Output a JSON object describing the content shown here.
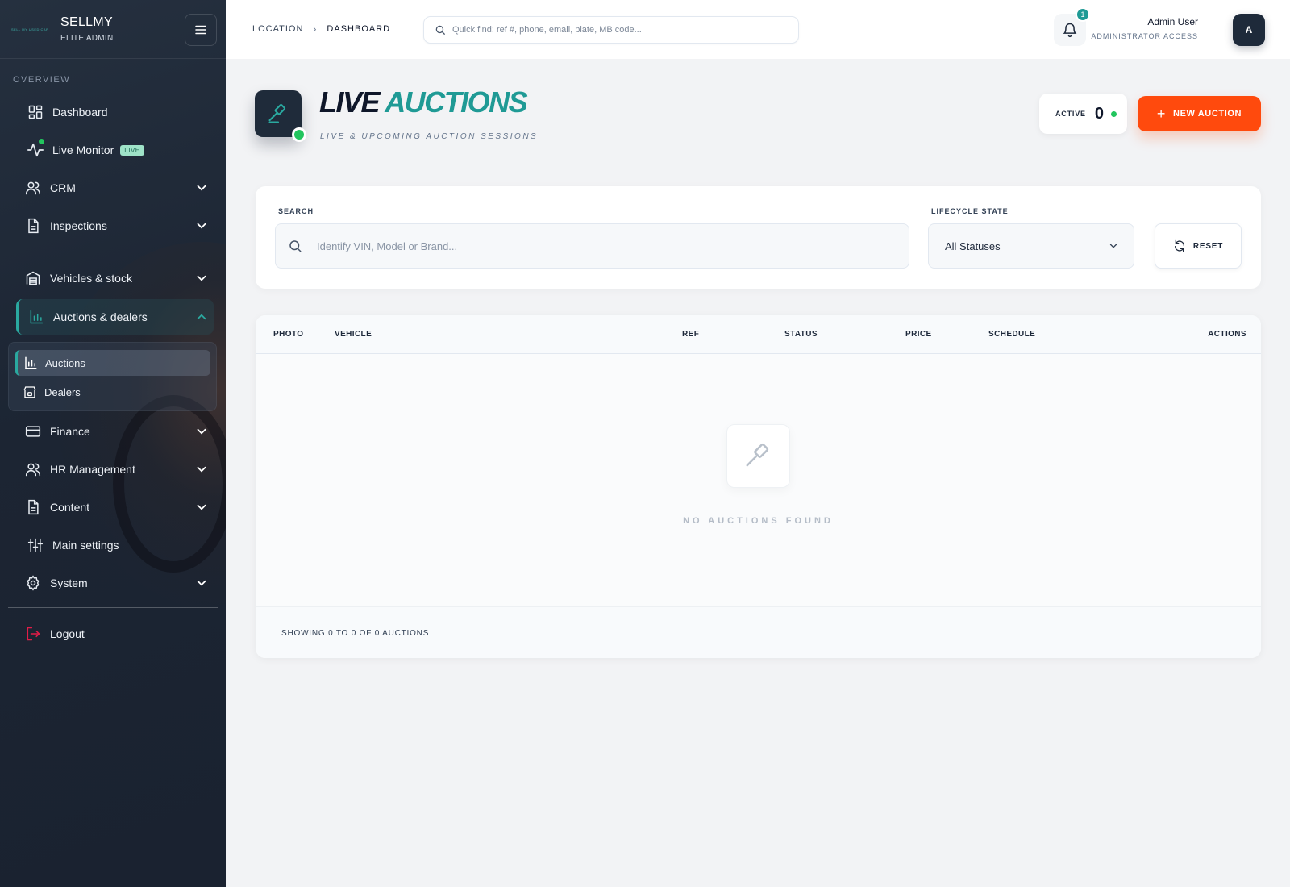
{
  "brand": {
    "logo_text": "SELL MY USED CAR",
    "name": "SELLMY",
    "subtitle": "ELITE ADMIN"
  },
  "sidebar": {
    "section_label": "OVERVIEW",
    "items": [
      {
        "label": "Dashboard",
        "icon": "dashboard-icon"
      },
      {
        "label": "Live Monitor",
        "icon": "activity-icon",
        "badge": "LIVE"
      },
      {
        "label": "CRM",
        "icon": "users-icon"
      },
      {
        "label": "Inspections",
        "icon": "document-icon"
      },
      {
        "label": "Vehicles & stock",
        "icon": "garage-icon"
      },
      {
        "label": "Auctions & dealers",
        "icon": "bar-chart-icon",
        "expanded": true
      },
      {
        "label": "Finance",
        "icon": "credit-card-icon"
      },
      {
        "label": "HR Management",
        "icon": "users-icon"
      },
      {
        "label": "Content",
        "icon": "document-icon"
      },
      {
        "label": "Main settings",
        "icon": "sliders-icon"
      },
      {
        "label": "System",
        "icon": "gear-icon"
      }
    ],
    "subitems": [
      {
        "label": "Auctions",
        "icon": "bar-chart-icon",
        "active": true
      },
      {
        "label": "Dealers",
        "icon": "store-icon"
      }
    ],
    "logout_label": "Logout"
  },
  "topbar": {
    "breadcrumb": [
      "LOCATION",
      "DASHBOARD"
    ],
    "quick_find_placeholder": "Quick find: ref #, phone, email, plate, MB code...",
    "notification_count": "1",
    "user_name": "Admin User",
    "user_role": "ADMINISTRATOR ACCESS",
    "avatar_initial": "A"
  },
  "header": {
    "title_part1": "LIVE",
    "title_part2": "AUCTIONS",
    "subtitle": "LIVE & UPCOMING AUCTION SESSIONS",
    "active_label": "ACTIVE",
    "active_count": "0",
    "new_button_label": "NEW AUCTION"
  },
  "filters": {
    "search_label": "SEARCH",
    "search_placeholder": "Identify VIN, Model or Brand...",
    "lifecycle_label": "LIFECYCLE STATE",
    "lifecycle_value": "All Statuses",
    "reset_label": "RESET"
  },
  "table": {
    "columns": [
      "PHOTO",
      "VEHICLE",
      "REF",
      "STATUS",
      "PRICE",
      "SCHEDULE",
      "ACTIONS"
    ],
    "rows": [],
    "empty_text": "NO AUCTIONS FOUND",
    "footer_text": "SHOWING 0 TO 0 OF 0 AUCTIONS"
  },
  "colors": {
    "accent_teal": "#1f9a95",
    "cta_orange": "#ff4a0d",
    "sidebar_bg": "#1c2533",
    "status_green": "#22c55e",
    "logout_red": "#e11d48"
  }
}
